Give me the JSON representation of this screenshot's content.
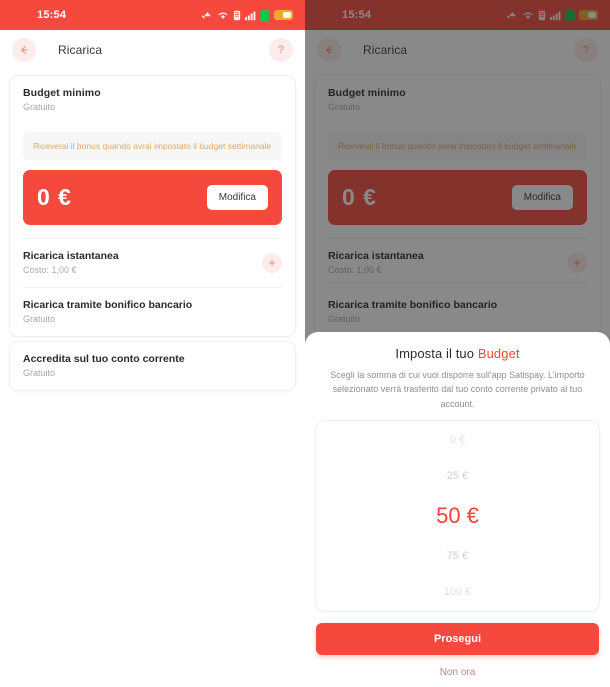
{
  "statusbar": {
    "time": "15:54",
    "icons": [
      "cast-icon",
      "wifi-icon",
      "sim-icon",
      "signal-icon",
      "vpn-icon",
      "battery-icon"
    ]
  },
  "appbar": {
    "back_icon": "back-arrow-icon",
    "title": "Ricarica",
    "help_label": "?"
  },
  "budget_card": {
    "title": "Budget minimo",
    "subtitle": "Gratuito",
    "notice": "Riceverai il bonus quando avrai impostato il budget settimanale",
    "amount": "0 €",
    "edit_label": "Modifica"
  },
  "options": [
    {
      "title": "Ricarica istantanea",
      "subtitle": "Costo: 1,00 €",
      "action_icon": "plus-icon"
    },
    {
      "title": "Ricarica tramite bonifico bancario",
      "subtitle": "Gratuito"
    }
  ],
  "second_card": {
    "title": "Accredita sul tuo conto corrente",
    "subtitle": "Gratuito"
  },
  "sheet": {
    "title_plain": "Imposta il tuo ",
    "title_accent": "Budget",
    "description": "Scegli la somma di cui vuoi disporre sull'app Satispay. L'importo selezionato verrà trasferito dal tuo conto corrente privato al tuo account.",
    "picker": {
      "options": [
        "0 €",
        "25 €",
        "50 €",
        "75 €",
        "100 €"
      ],
      "selected_index": 2,
      "selected_value": "50 €"
    },
    "primary_label": "Prosegui",
    "secondary_label": "Non ora"
  },
  "colors": {
    "brand_red": "#f5493d",
    "accent_red": "#f04438",
    "notice_text": "#dca96b",
    "muted": "#a9a9ad",
    "overlay": "rgba(28,28,28,0.52)"
  }
}
